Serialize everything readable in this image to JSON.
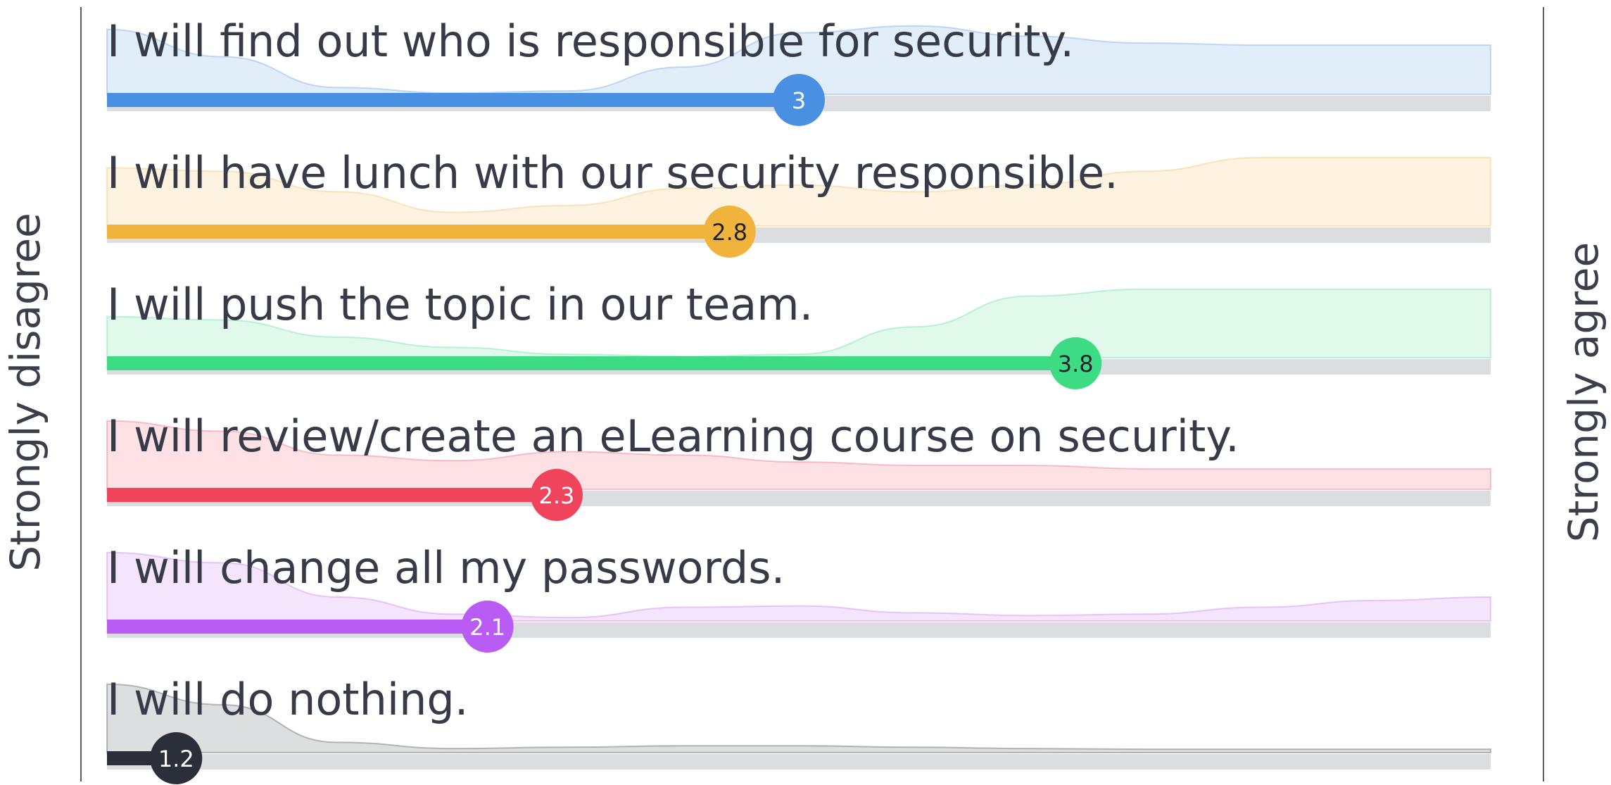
{
  "chart_data": {
    "type": "bar",
    "scale": {
      "min": 1,
      "max": 5
    },
    "left_label": "Strongly disagree",
    "right_label": "Strongly agree",
    "items": [
      {
        "label": "I will find out who is responsible for security.",
        "value": 3,
        "value_label": "3",
        "color": "#4a90e2",
        "distribution": [
          0.95,
          0.55,
          0.1,
          0.02,
          0.05,
          0.4,
          0.9,
          1.0,
          0.85,
          0.75,
          0.72,
          0.72,
          0.72
        ]
      },
      {
        "label": "I will have lunch with our security responsible.",
        "value": 2.8,
        "value_label": "2.8",
        "color": "#f0b43c",
        "distribution": [
          0.85,
          0.8,
          0.5,
          0.2,
          0.3,
          0.55,
          0.6,
          0.5,
          0.6,
          0.8,
          1.0,
          1.0,
          1.0
        ]
      },
      {
        "label": "I will push the topic in our team.",
        "value": 3.8,
        "value_label": "3.8",
        "color": "#3ddc84",
        "distribution": [
          0.6,
          0.55,
          0.3,
          0.15,
          0.05,
          0.02,
          0.05,
          0.45,
          0.9,
          1.0,
          1.0,
          1.0,
          1.0
        ]
      },
      {
        "label": "I will review/create an eLearning course on security.",
        "value": 2.3,
        "value_label": "2.3",
        "color": "#f0445c",
        "distribution": [
          1.0,
          0.85,
          0.5,
          0.42,
          0.55,
          0.5,
          0.4,
          0.35,
          0.35,
          0.3,
          0.3,
          0.3,
          0.3
        ]
      },
      {
        "label": "I will change all my passwords.",
        "value": 2.1,
        "value_label": "2.1",
        "color": "#b95cf4",
        "distribution": [
          1.0,
          0.85,
          0.35,
          0.1,
          0.05,
          0.2,
          0.22,
          0.12,
          0.08,
          0.1,
          0.2,
          0.3,
          0.35
        ]
      },
      {
        "label": "I will do nothing.",
        "value": 1.2,
        "value_label": "1.2",
        "color": "#2b2f3a",
        "distribution": [
          1.0,
          0.7,
          0.15,
          0.06,
          0.08,
          0.1,
          0.1,
          0.08,
          0.06,
          0.05,
          0.05,
          0.05,
          0.05
        ]
      }
    ]
  }
}
